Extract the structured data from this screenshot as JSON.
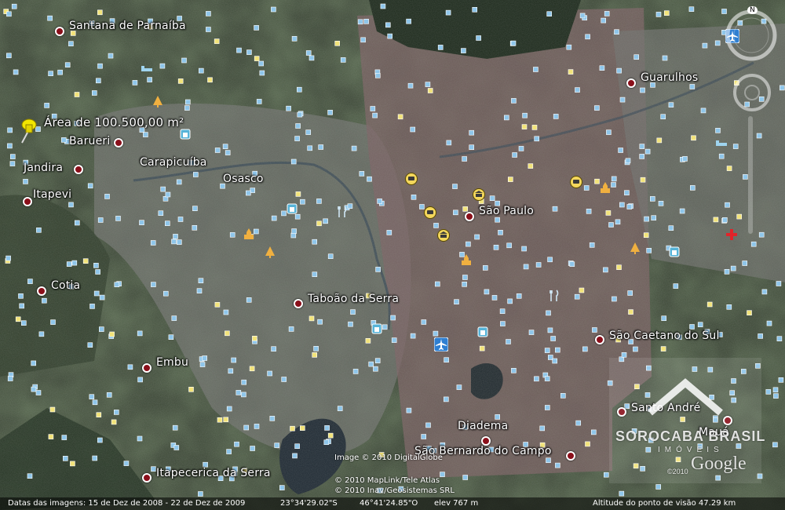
{
  "places": [
    {
      "name": "Santana de Parnaíba"
    },
    {
      "name": "Barueri"
    },
    {
      "name": "Jandira"
    },
    {
      "name": "Itapevi"
    },
    {
      "name": "Carapicuíba"
    },
    {
      "name": "Osasco"
    },
    {
      "name": "Cotia"
    },
    {
      "name": "Embu"
    },
    {
      "name": "Itapecerica da Serra"
    },
    {
      "name": "Taboão da Serra"
    },
    {
      "name": "São Paulo"
    },
    {
      "name": "Guarulhos"
    },
    {
      "name": "São Caetano do Sul"
    },
    {
      "name": "Santo André"
    },
    {
      "name": "Mauá"
    },
    {
      "name": "Diadema"
    },
    {
      "name": "São Bernardo do Campo"
    }
  ],
  "placemark": {
    "label": "Área de 100.500,00 m²",
    "icon": "yellow-pushpin-icon",
    "color": "#f2e600"
  },
  "credits": {
    "digitalglobe": "Image © 2010 DigitalGlobe",
    "maplink": "© 2010 MapLink/Tele Atlas",
    "inav": "© 2010 Inav/Geosistemas SRL"
  },
  "status_bar": {
    "imagery_dates": "Datas das imagens: 15 de Dez de 2008 - 22 de Dez de 2009",
    "latitude": "23°34'29.02\"S",
    "longitude": "46°41'24.85\"O",
    "elevation": "elev  767 m",
    "eye_altitude": "Altitude do ponto de visão    47.29 km"
  },
  "watermark": {
    "brand": "SOROCABA BRASIL",
    "subtitle": "IMÓVEIS",
    "logo": "Google",
    "year": "©2010"
  },
  "navigation": {
    "north": "N"
  },
  "poi_icons": [
    "airplane-icon",
    "bus-icon",
    "museum-icon",
    "shopping-bag-icon",
    "church-icon",
    "restaurant-icon",
    "hospital-icon",
    "tree-icon",
    "bed-icon"
  ],
  "colors": {
    "city_dot": "#8a0f1a",
    "poi_square": "#8fc6ea",
    "poi_square_yellow": "#f2e37a",
    "hospital": "#e0242a"
  }
}
